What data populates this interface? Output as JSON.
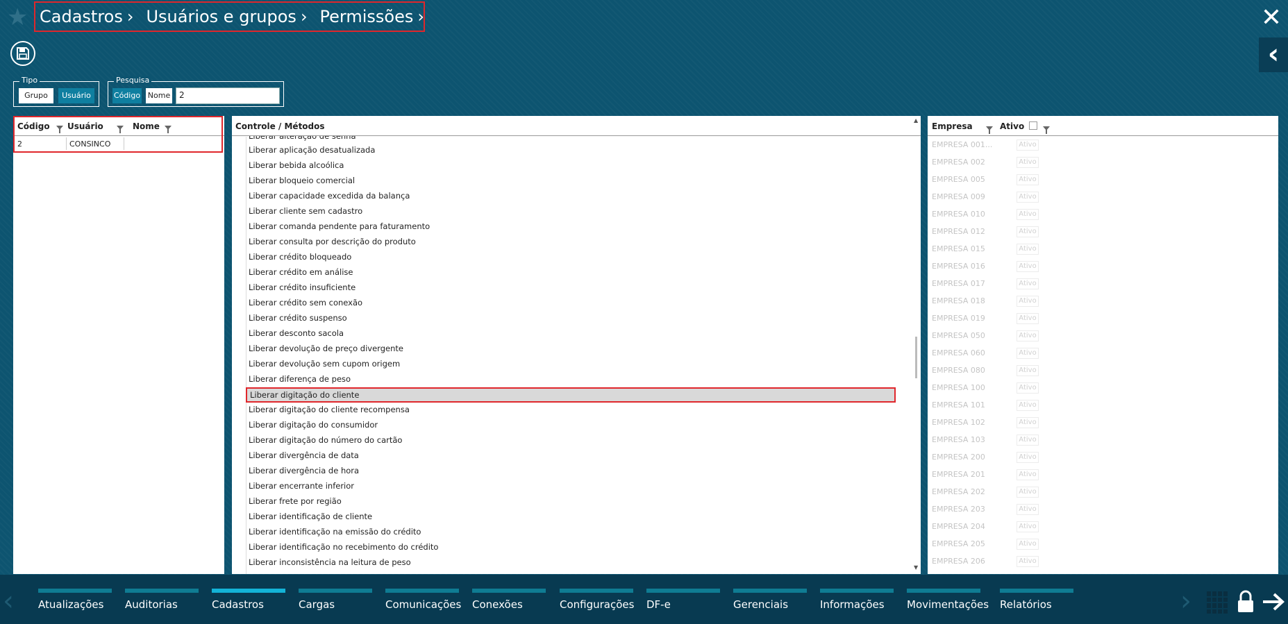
{
  "breadcrumb": [
    "Cadastros",
    "Usuários e grupos",
    "Permissões"
  ],
  "icons": {
    "favorite": "star-icon",
    "close": "close-icon",
    "back": "chevron-left-icon",
    "save": "floppy-disk-icon",
    "grid": "grid-icon",
    "lock": "lock-icon",
    "logout": "arrow-right-icon"
  },
  "tipo": {
    "legend": "Tipo",
    "options": [
      "Grupo",
      "Usuário"
    ],
    "selected": "Usuário"
  },
  "pesquisa": {
    "legend": "Pesquisa",
    "options": [
      "Código",
      "Nome"
    ],
    "selected": "Código",
    "value": "2"
  },
  "users": {
    "columns": [
      "Código",
      "Usuário",
      "Nome"
    ],
    "rows": [
      {
        "codigo": "2",
        "usuario": "CONSINCO",
        "nome": ""
      }
    ]
  },
  "methods": {
    "header": "Controle / Métodos",
    "partial_top": "Liberar alteração de senha",
    "items": [
      "Liberar aplicação desatualizada",
      "Liberar bebida alcoólica",
      "Liberar bloqueio comercial",
      "Liberar capacidade excedida da balança",
      "Liberar cliente sem cadastro",
      "Liberar comanda pendente para faturamento",
      "Liberar consulta por descrição do produto",
      "Liberar crédito bloqueado",
      "Liberar crédito em análise",
      "Liberar crédito insuficiente",
      "Liberar crédito sem conexão",
      "Liberar crédito suspenso",
      "Liberar desconto sacola",
      "Liberar devolução de preço divergente",
      "Liberar devolução sem cupom origem",
      "Liberar diferença de peso",
      "Liberar digitação do cliente",
      "Liberar digitação do cliente recompensa",
      "Liberar digitação do consumidor",
      "Liberar digitação do número do cartão",
      "Liberar divergência de data",
      "Liberar divergência de hora",
      "Liberar encerrante inferior",
      "Liberar frete por região",
      "Liberar identificação de cliente",
      "Liberar identificação na emissão do crédito",
      "Liberar identificação no recebimento do crédito",
      "Liberar inconsistência na leitura de peso"
    ],
    "selected": "Liberar digitação do cliente"
  },
  "empresas": {
    "columns": [
      "Empresa",
      "Ativo"
    ],
    "ativo_label": "Ativo",
    "rows": [
      "EMPRESA 001...",
      "EMPRESA 002",
      "EMPRESA 005",
      "EMPRESA 009",
      "EMPRESA 010",
      "EMPRESA 012",
      "EMPRESA 015",
      "EMPRESA 016",
      "EMPRESA 017",
      "EMPRESA 018",
      "EMPRESA 019",
      "EMPRESA 050",
      "EMPRESA 060",
      "EMPRESA 080",
      "EMPRESA 100",
      "EMPRESA 101",
      "EMPRESA 102",
      "EMPRESA 103",
      "EMPRESA 200",
      "EMPRESA 201",
      "EMPRESA 202",
      "EMPRESA 203",
      "EMPRESA 204",
      "EMPRESA 205",
      "EMPRESA 206"
    ]
  },
  "bottom_nav": {
    "items": [
      "Atualizações",
      "Auditorias",
      "Cadastros",
      "Cargas",
      "Comunicações",
      "Conexões",
      "Configurações",
      "DF-e",
      "Gerenciais",
      "Informações",
      "Movimentações",
      "Relatórios"
    ],
    "active": "Cadastros"
  },
  "colors": {
    "accent": "#13b3d7",
    "background": "#0d5470",
    "highlight_border": "#e0262b",
    "selected_row": "#d9d9d9"
  }
}
